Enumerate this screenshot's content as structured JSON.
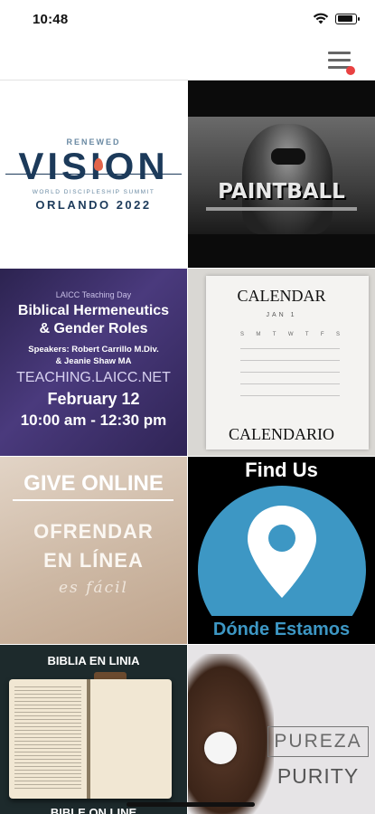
{
  "status": {
    "time": "10:48"
  },
  "header": {
    "menu_icon": "hamburger-menu-icon",
    "notification_color": "#e94242"
  },
  "tiles": {
    "vision": {
      "renewed": "RENEWED",
      "vision": "VISION",
      "summit": "WORLD DISCIPLESHIP SUMMIT",
      "location": "ORLANDO 2022"
    },
    "paintball": {
      "title": "PAINTBALL"
    },
    "laicc": {
      "small": "LAICC Teaching Day",
      "title_line1": "Biblical Hermeneutics",
      "title_line2": "& Gender Roles",
      "speakers_line1": "Speakers: Robert Carrillo M.Div.",
      "speakers_line2": "& Jeanie Shaw MA",
      "url": "TEACHING.LAICC.NET",
      "date": "February 12",
      "time": "10:00 am - 12:30 pm"
    },
    "calendar": {
      "top": "CALENDAR",
      "month": "JAN 1",
      "weekdays": [
        "S",
        "M",
        "T",
        "W",
        "T",
        "F",
        "S"
      ],
      "bottom": "CALENDARIO"
    },
    "give": {
      "title": "GIVE ONLINE",
      "spanish_line1": "OFRENDAR",
      "spanish_line2": "EN LÍNEA",
      "easy": "es fácil"
    },
    "find": {
      "title": "Find Us",
      "label": "Dónde Estamos",
      "accent": "#3d97c4"
    },
    "bible": {
      "title": "BIBLIA EN LINIA",
      "bottom": "BIBLE ON LINE"
    },
    "purity": {
      "spanish": "PUREZA",
      "english": "PURITY"
    }
  }
}
